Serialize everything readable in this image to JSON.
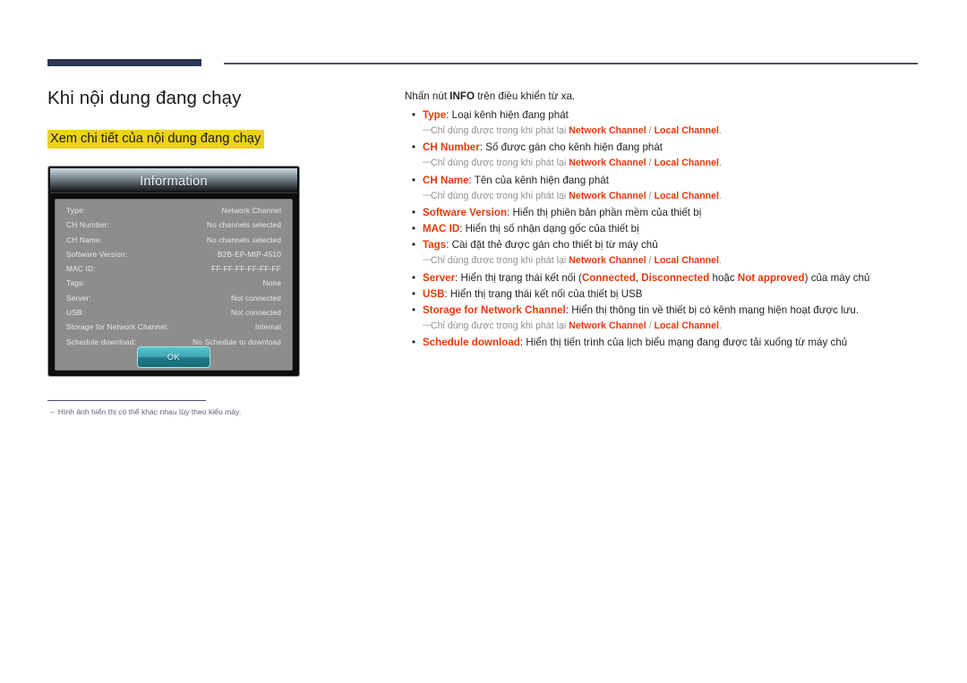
{
  "page": {
    "title": "Khi nội dung đang chạy",
    "subtitle": "Xem chi tiết của nội dung đang chạy",
    "footnote_dash": "–",
    "footnote_text": "Hình ảnh hiển thị có thể khác nhau tùy theo kiểu máy."
  },
  "colors": {
    "accent_red": "#e8380d",
    "highlight_yellow": "#ecd11d",
    "rule_navy": "#2b3756",
    "rule_line": "#4d4f69",
    "subnote_gray": "#8f9196",
    "dialog_body_gray": "#8d8d8d",
    "ok_button_teal": "#1f7a87"
  },
  "dialog": {
    "title": "Information",
    "rows": [
      {
        "label": "Type:",
        "value": "Network Channel"
      },
      {
        "label": "CH Number:",
        "value": "No channels selected"
      },
      {
        "label": "CH Name:",
        "value": "No channels selected"
      },
      {
        "label": "Software Version:",
        "value": "B2B-EP-MIP-4510"
      },
      {
        "label": "MAC ID:",
        "value": "FF-FF-FF-FF-FF-FF"
      },
      {
        "label": "Tags:",
        "value": "None"
      },
      {
        "label": "Server:",
        "value": "Not connected"
      },
      {
        "label": "USB:",
        "value": "Not connected"
      },
      {
        "label": "Storage for Network Channel:",
        "value": "Internal"
      },
      {
        "label": "Schedule download:",
        "value": "No Schedule to download"
      }
    ],
    "ok_label": "OK"
  },
  "content": {
    "intro_prefix": "Nhấn nút ",
    "intro_bold": "INFO",
    "intro_suffix": " trên điều khiển từ xa.",
    "bullet_char": "•",
    "subnote_dash": "—",
    "subnote_body": "Chỉ dùng được trong khi phát lại ",
    "subnote_ch1": "Network Channel",
    "subnote_sep": " / ",
    "subnote_ch2": "Local Channel",
    "subnote_end": ".",
    "items": [
      {
        "term": "Type",
        "desc": ": Loại kênh hiện đang phát",
        "has_note": true
      },
      {
        "term": "CH Number",
        "desc": ": Số được gán cho kênh hiện đang phát",
        "has_note": true
      },
      {
        "term": "CH Name",
        "desc": ": Tên của kênh hiện đang phát",
        "has_note": true
      },
      {
        "term": "Software Version",
        "desc": ": Hiển thị phiên bản phần mềm của thiết bị",
        "has_note": false
      },
      {
        "term": "MAC ID",
        "desc": ": Hiển thị số nhận dạng gốc của thiết bị",
        "has_note": false
      },
      {
        "term": "Tags",
        "desc": ": Cài đặt thẻ được gán cho thiết bị từ máy chủ",
        "has_note": true
      },
      {
        "term": "Server",
        "desc": "",
        "has_note": false,
        "special": "server"
      },
      {
        "term": "USB",
        "desc": ": Hiển thị trạng thái kết nối của thiết bị USB",
        "has_note": false
      },
      {
        "term": "Storage for Network Channel",
        "desc": ": Hiển thị thông tin về thiết bị có kênh mạng hiện hoạt được lưu.",
        "has_note": true
      },
      {
        "term": "Schedule download",
        "desc": ": Hiển thị tiến trình của lịch biểu mạng đang được tải xuống từ máy chủ",
        "has_note": false
      }
    ],
    "server_line": {
      "part1": ": Hiển thị trạng thái kết nối (",
      "status1": "Connected",
      "sep1": ", ",
      "status2": "Disconnected",
      "mid": " hoặc ",
      "status3": "Not approved",
      "part2": ") của máy chủ"
    }
  }
}
